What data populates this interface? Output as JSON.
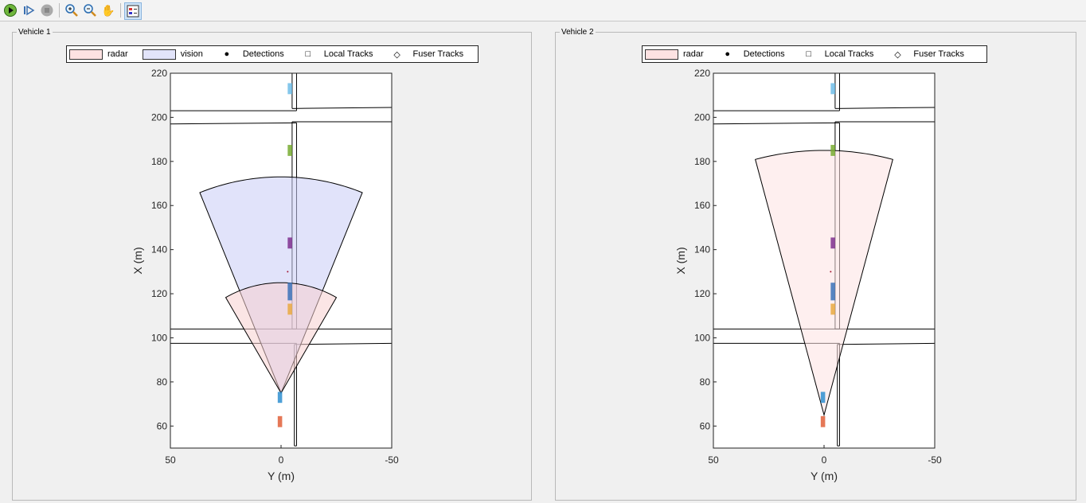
{
  "toolbar": {
    "buttons": [
      {
        "name": "run-button",
        "icon": "▶"
      },
      {
        "name": "step-button",
        "icon": "⏵"
      },
      {
        "name": "stop-button",
        "icon": "■"
      },
      {
        "name": "zoom-in-button",
        "icon": "+"
      },
      {
        "name": "zoom-out-button",
        "icon": "−"
      },
      {
        "name": "pan-button",
        "icon": "✋"
      },
      {
        "name": "legend-toggle-button",
        "icon": "☷"
      }
    ]
  },
  "colors": {
    "radar": "#fde2e2",
    "vision": "#e2e4fa",
    "road": "#000000"
  },
  "panels": [
    {
      "title": "Vehicle 1",
      "legend": {
        "radar": "radar",
        "vision": "vision",
        "detections": "Detections",
        "local": "Local Tracks",
        "fuser": "Fuser Tracks"
      }
    },
    {
      "title": "Vehicle 2",
      "legend": {
        "radar": "radar",
        "detections": "Detections",
        "local": "Local Tracks",
        "fuser": "Fuser Tracks"
      }
    }
  ],
  "chart_data": [
    {
      "type": "scatter",
      "title": "Vehicle 1",
      "xlabel": "Y (m)",
      "ylabel": "X (m)",
      "xlim": [
        50,
        -50
      ],
      "ylim": [
        50,
        220
      ],
      "xticks": [
        "50",
        "0",
        "-50"
      ],
      "yticks": [
        "60",
        "80",
        "100",
        "120",
        "140",
        "160",
        "180",
        "200",
        "220"
      ],
      "sensors": [
        {
          "name": "vision",
          "apex": [
            75,
            0
          ],
          "range": 98,
          "half_angle": 22,
          "color": "#c8ccf6"
        },
        {
          "name": "radar",
          "apex": [
            75,
            0
          ],
          "range": 50,
          "half_angle": 30,
          "color": "#f8cfcf"
        }
      ],
      "vehicles": [
        {
          "x": 213,
          "y": -4,
          "color": "#6fbde8"
        },
        {
          "x": 185,
          "y": -4,
          "color": "#77ac30"
        },
        {
          "x": 143,
          "y": -4,
          "color": "#7e2f8e"
        },
        {
          "x": 121,
          "y": -4,
          "color": "#3a72b8",
          "long": true
        },
        {
          "x": 113,
          "y": -4,
          "color": "#e9a940"
        },
        {
          "x": 73,
          "y": 0.5,
          "color": "#2f8fd0"
        },
        {
          "x": 62,
          "y": 0.5,
          "color": "#e0603a"
        }
      ],
      "detections": [
        {
          "x": 130,
          "y": -3,
          "color": "#a2142f"
        }
      ]
    },
    {
      "type": "scatter",
      "title": "Vehicle 2",
      "xlabel": "Y (m)",
      "ylabel": "X (m)",
      "xlim": [
        50,
        -50
      ],
      "ylim": [
        50,
        220
      ],
      "xticks": [
        "50",
        "0",
        "-50"
      ],
      "yticks": [
        "60",
        "80",
        "100",
        "120",
        "140",
        "160",
        "180",
        "200",
        "220"
      ],
      "sensors": [
        {
          "name": "radar",
          "apex": [
            65,
            0
          ],
          "range": 120,
          "half_angle": 15,
          "color": "#fde2e2"
        }
      ],
      "vehicles": [
        {
          "x": 213,
          "y": -4,
          "color": "#6fbde8"
        },
        {
          "x": 185,
          "y": -4,
          "color": "#77ac30"
        },
        {
          "x": 143,
          "y": -4,
          "color": "#7e2f8e"
        },
        {
          "x": 121,
          "y": -4,
          "color": "#3a72b8",
          "long": true
        },
        {
          "x": 113,
          "y": -4,
          "color": "#e9a940"
        },
        {
          "x": 73,
          "y": 0.5,
          "color": "#2f8fd0"
        },
        {
          "x": 62,
          "y": 0.5,
          "color": "#e0603a"
        }
      ],
      "detections": [
        {
          "x": 130,
          "y": -3,
          "color": "#a2142f"
        }
      ]
    }
  ]
}
